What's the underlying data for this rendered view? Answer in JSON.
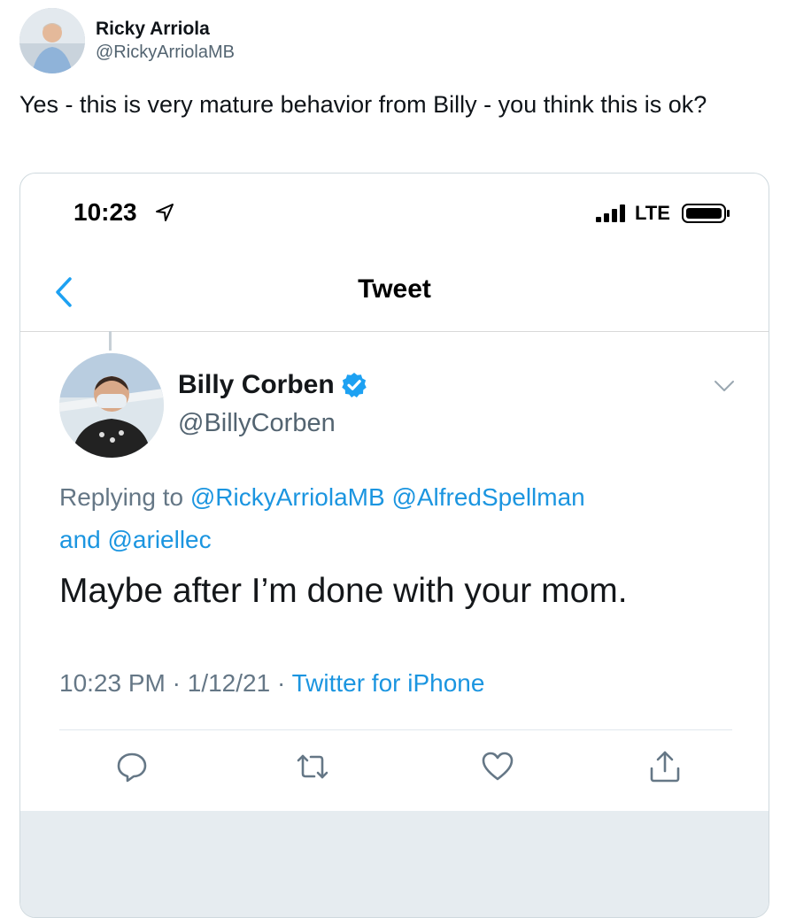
{
  "outer_tweet": {
    "name": "Ricky Arriola",
    "handle": "@RickyArriolaMB",
    "text": "Yes - this is very mature behavior from Billy - you think this is ok?"
  },
  "phone": {
    "status_time": "10:23",
    "network": "LTE",
    "nav_title": "Tweet"
  },
  "inner_tweet": {
    "name": "Billy Corben",
    "handle": "@BillyCorben",
    "replying_prefix": "Replying to",
    "mentions": [
      "@RickyArriolaMB",
      "@AlfredSpellman"
    ],
    "replying_and": "and",
    "mention_last": "@ariellec",
    "text": "Maybe after I’m done with your mom.",
    "time": "10:23 PM",
    "date": "1/12/21",
    "separator": "·",
    "source": "Twitter for iPhone"
  },
  "icons": {
    "location": "location-arrow-icon",
    "signal": "signal-bars-icon",
    "battery": "battery-icon",
    "back": "chevron-left-icon",
    "verified": "verified-badge-icon",
    "more": "chevron-down-icon",
    "reply": "reply-icon",
    "retweet": "retweet-icon",
    "like": "heart-icon",
    "share": "share-icon"
  },
  "colors": {
    "link_blue": "#1b95e0",
    "muted_gray": "#657786",
    "verified_blue": "#1da1f2"
  }
}
